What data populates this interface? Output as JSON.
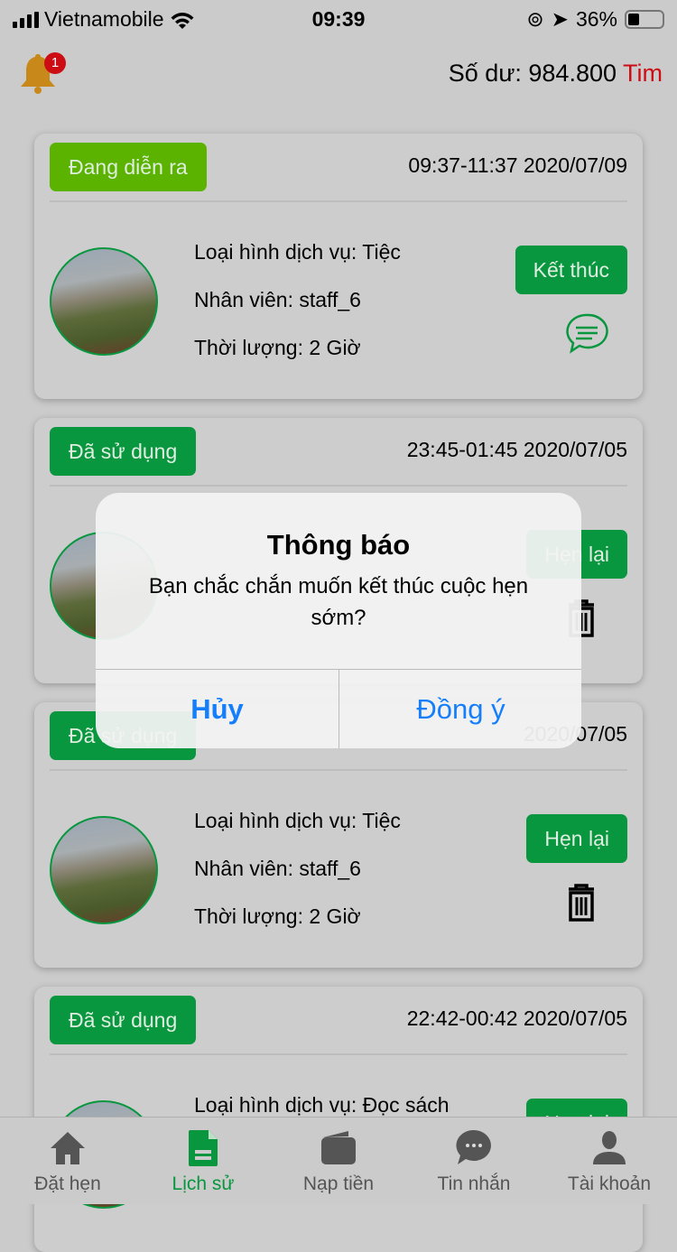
{
  "status_bar": {
    "carrier": "Vietnamobile",
    "time": "09:39",
    "battery": "36%",
    "battery_level": 0.36
  },
  "header": {
    "notification_count": "1",
    "balance_label": "Số dư: 984.800",
    "currency": "Tim"
  },
  "colors": {
    "primary": "#08963f",
    "live": "#5bb300",
    "badge": "#cc0d14",
    "link": "#147efb"
  },
  "cards": [
    {
      "status": "Đang diễn ra",
      "time": "09:37-11:37 2020/07/09",
      "service": "Loại hình dịch vụ: Tiệc",
      "staff": "Nhân viên: staff_6",
      "duration": "Thời lượng: 2 Giờ",
      "action": "Kết thúc",
      "icon": "chat-icon"
    },
    {
      "status": "Đã sử dụng",
      "time": "23:45-01:45 2020/07/05",
      "action": "Hẹn lại",
      "icon": "trash-icon"
    },
    {
      "status": "Đã sử dụng",
      "time": "2020/07/05",
      "service": "Loại hình dịch vụ: Tiệc",
      "staff": "Nhân viên: staff_6",
      "duration": "Thời lượng: 2 Giờ",
      "action": "Hẹn lại",
      "icon": "trash-icon"
    },
    {
      "status": "Đã sử dụng",
      "time": "22:42-00:42 2020/07/05",
      "service": "Loại hình dịch vụ: Đọc sách",
      "action": "Hẹn lại"
    }
  ],
  "dialog": {
    "title": "Thông báo",
    "message": "Bạn chắc chắn muốn kết thúc cuộc hẹn sớm?",
    "cancel": "Hủy",
    "confirm": "Đồng ý"
  },
  "tabs": [
    {
      "label": "Đặt hẹn",
      "icon": "home-icon"
    },
    {
      "label": "Lịch sử",
      "icon": "document-icon",
      "active": true
    },
    {
      "label": "Nạp tiền",
      "icon": "wallet-icon"
    },
    {
      "label": "Tin nhắn",
      "icon": "message-icon"
    },
    {
      "label": "Tài khoản",
      "icon": "user-icon"
    }
  ]
}
